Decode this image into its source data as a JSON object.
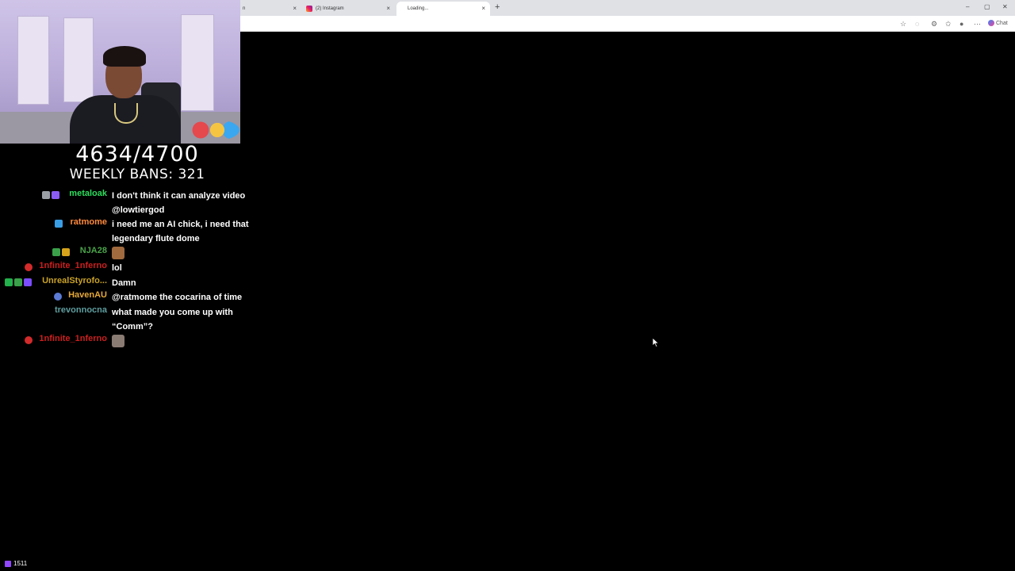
{
  "browser": {
    "tabs": [
      {
        "title": "n",
        "close": "×"
      },
      {
        "title": "(2) Instagram",
        "close": "×"
      },
      {
        "title": "Loading...",
        "close": "×"
      }
    ],
    "new_tab": "+",
    "window_controls": [
      "–",
      "▢",
      "✕"
    ],
    "toolbar_icons": [
      "star-icon",
      "extensions-icon",
      "sync-icon",
      "favorites-icon",
      "profile-icon",
      "more-icon"
    ],
    "chat_label": "Chat"
  },
  "counter": {
    "count": "4634/4700",
    "weekly": "WEEKLY BANS: 321"
  },
  "chat": {
    "messages": [
      {
        "user": "metaloak",
        "color": "#2bde5c",
        "lines": [
          "I don't think it can analyze video",
          "@lowtiergod"
        ],
        "badges": [
          "#9aa0a6",
          "#8a5cf6"
        ]
      },
      {
        "user": "ratmome",
        "color": "#ff8a3d",
        "lines": [
          "i need me an AI chick, i need that",
          "legendary flute dome"
        ],
        "badges": [
          "#3a9ee6"
        ]
      },
      {
        "user": "NJA28",
        "color": "#4aa34a",
        "lines": [],
        "emote": "emote-face",
        "badges": [
          "#3aa14a",
          "#d6a31a"
        ]
      },
      {
        "user": "1nfinite_1nferno",
        "color": "#cc1f1f",
        "lines": [
          "lol"
        ],
        "badges": [
          "#d22b2b"
        ]
      },
      {
        "user": "UnrealStyrofo...",
        "color": "#c9a227",
        "lines": [
          "Damn"
        ],
        "badges": [
          "#22b14c",
          "#3aa14a",
          "#7c4dff"
        ]
      },
      {
        "user": "HavenAU",
        "color": "#e6a93a",
        "lines": [
          "@ratmome the cocarina of time"
        ],
        "badges": [
          "#5b7bd5"
        ]
      },
      {
        "user": "trevonnocna",
        "color": "#5f9ea0",
        "lines": [
          "what made you come up with",
          "“Comm”?"
        ],
        "badges": []
      },
      {
        "user": "1nfinite_1nferno",
        "color": "#cc1f1f",
        "lines": [],
        "emote": "emote-meme",
        "badges": [
          "#d22b2b"
        ]
      }
    ]
  },
  "viewers": "1511"
}
